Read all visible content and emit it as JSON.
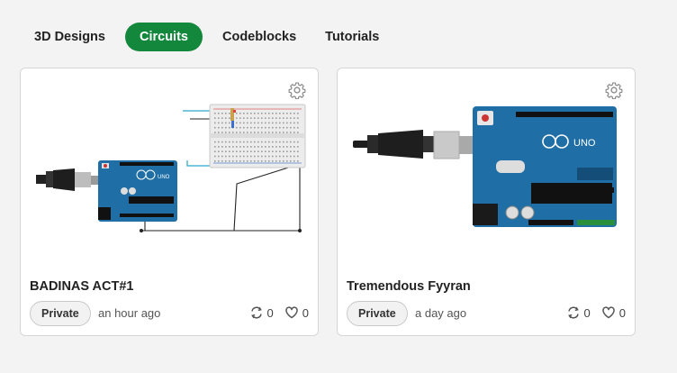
{
  "tabs": [
    {
      "label": "3D Designs",
      "active": false
    },
    {
      "label": "Circuits",
      "active": true
    },
    {
      "label": "Codeblocks",
      "active": false
    },
    {
      "label": "Tutorials",
      "active": false
    }
  ],
  "accent_color": "#13873c",
  "cards": [
    {
      "title": "BADINAS ACT#1",
      "visibility": "Private",
      "time": "an hour ago",
      "remixes": "0",
      "likes": "0",
      "thumbnail": "arduino-uno-breadboard-circuit",
      "board_label": "UNO"
    },
    {
      "title": "Tremendous Fyyran",
      "visibility": "Private",
      "time": "a day ago",
      "remixes": "0",
      "likes": "0",
      "thumbnail": "arduino-uno-board",
      "board_label": "UNO"
    }
  ],
  "icons": {
    "settings": "gear-icon",
    "remix": "remix-icon",
    "like": "heart-icon"
  }
}
